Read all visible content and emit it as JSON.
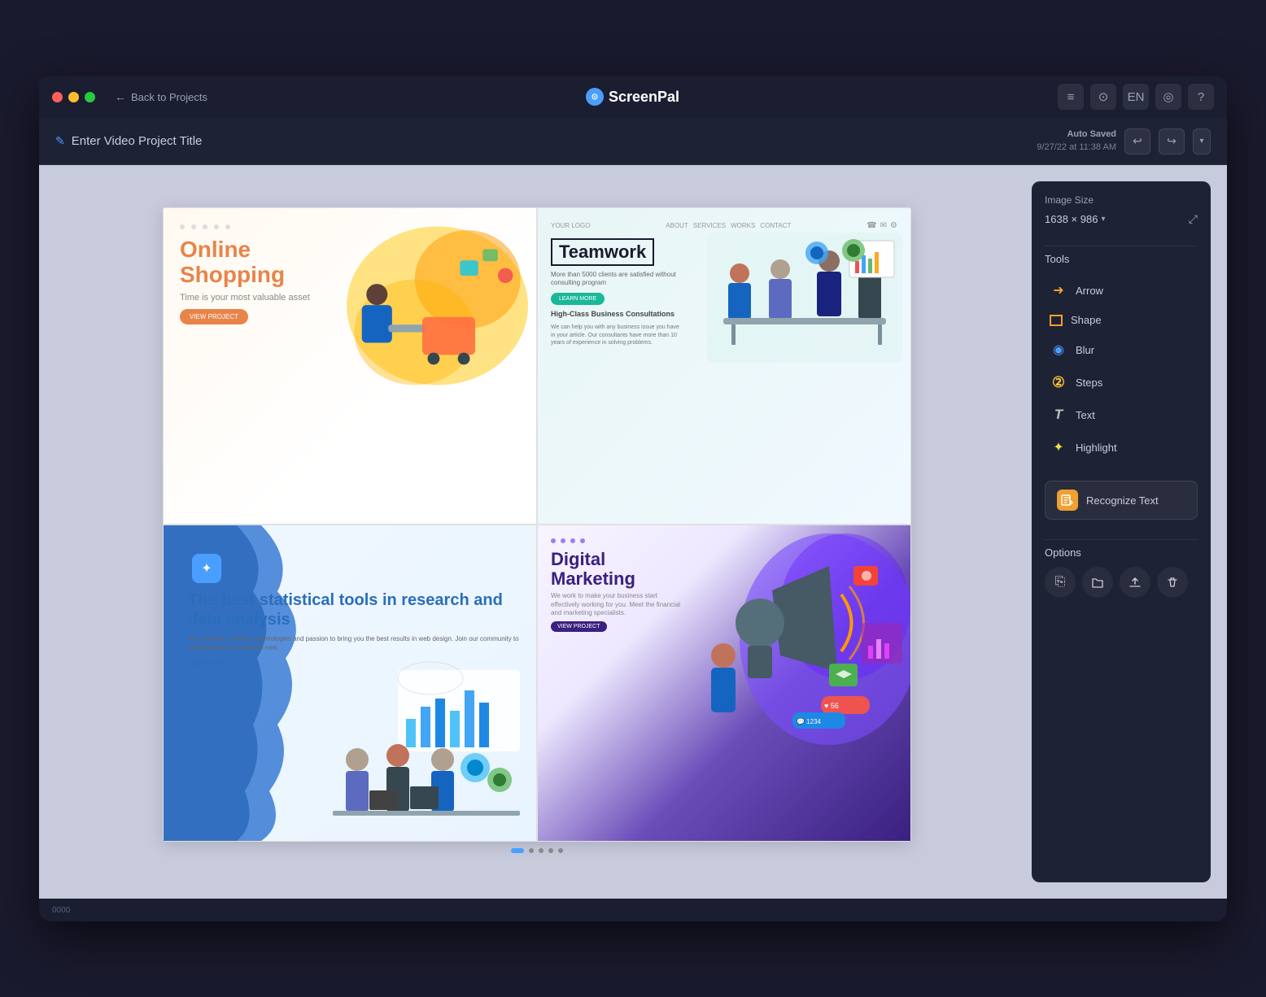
{
  "window": {
    "title": "ScreenPal",
    "back_label": "Back to Projects",
    "project_title": "Enter Video Project Title",
    "autosave_label": "Auto Saved",
    "autosave_time": "9/27/22 at 11:38 AM",
    "logo_text": "ScreenPal"
  },
  "toolbar_icons": {
    "list_icon": "≡",
    "clock_icon": "⊙",
    "lang_label": "EN",
    "layers_icon": "◎",
    "help_icon": "?"
  },
  "panel": {
    "image_size_label": "Image Size",
    "image_size_value": "1638 × 986",
    "tools_label": "Tools",
    "tools": [
      {
        "id": "arrow",
        "label": "Arrow",
        "icon": "→",
        "color": "#f0a030"
      },
      {
        "id": "shape",
        "label": "Shape",
        "icon": "□",
        "color": "#f0a030"
      },
      {
        "id": "blur",
        "label": "Blur",
        "icon": "◉",
        "color": "#4a9eff"
      },
      {
        "id": "steps",
        "label": "Steps",
        "icon": "②",
        "color": "#f0c030"
      },
      {
        "id": "text",
        "label": "Text",
        "icon": "T",
        "color": "#c0c0c0"
      },
      {
        "id": "highlight",
        "label": "Highlight",
        "icon": "✦",
        "color": "#f0e040"
      }
    ],
    "recognize_text_label": "Recognize Text",
    "options_label": "Options",
    "options": [
      {
        "id": "copy",
        "icon": "⎘"
      },
      {
        "id": "open",
        "icon": "📂"
      },
      {
        "id": "upload",
        "icon": "⬆"
      },
      {
        "id": "delete",
        "icon": "🗑"
      }
    ]
  },
  "canvas": {
    "cells": [
      {
        "id": "shopping",
        "title": "Online",
        "title2": "Shopping",
        "subtitle": "Time is your most valuable asset",
        "cta": "VIEW PROJECT"
      },
      {
        "id": "teamwork",
        "title": "Teamwork",
        "subtitle": "High-Class Business Consultations",
        "cta": "LEARN MORE"
      },
      {
        "id": "statistics",
        "title": "The best statistical tools in research and data analysis",
        "text": "We combine creativity, technologies and passion to bring you the best results in web design. Join our community to start building your website now.",
        "link": "LEARN MORE"
      },
      {
        "id": "marketing",
        "title": "Digital",
        "title2": "Marketing",
        "subtitle": "We work to make your business start effectively working for you. Meet the financial and marketing specialists.",
        "cta": "VIEW PROJECT"
      }
    ]
  }
}
